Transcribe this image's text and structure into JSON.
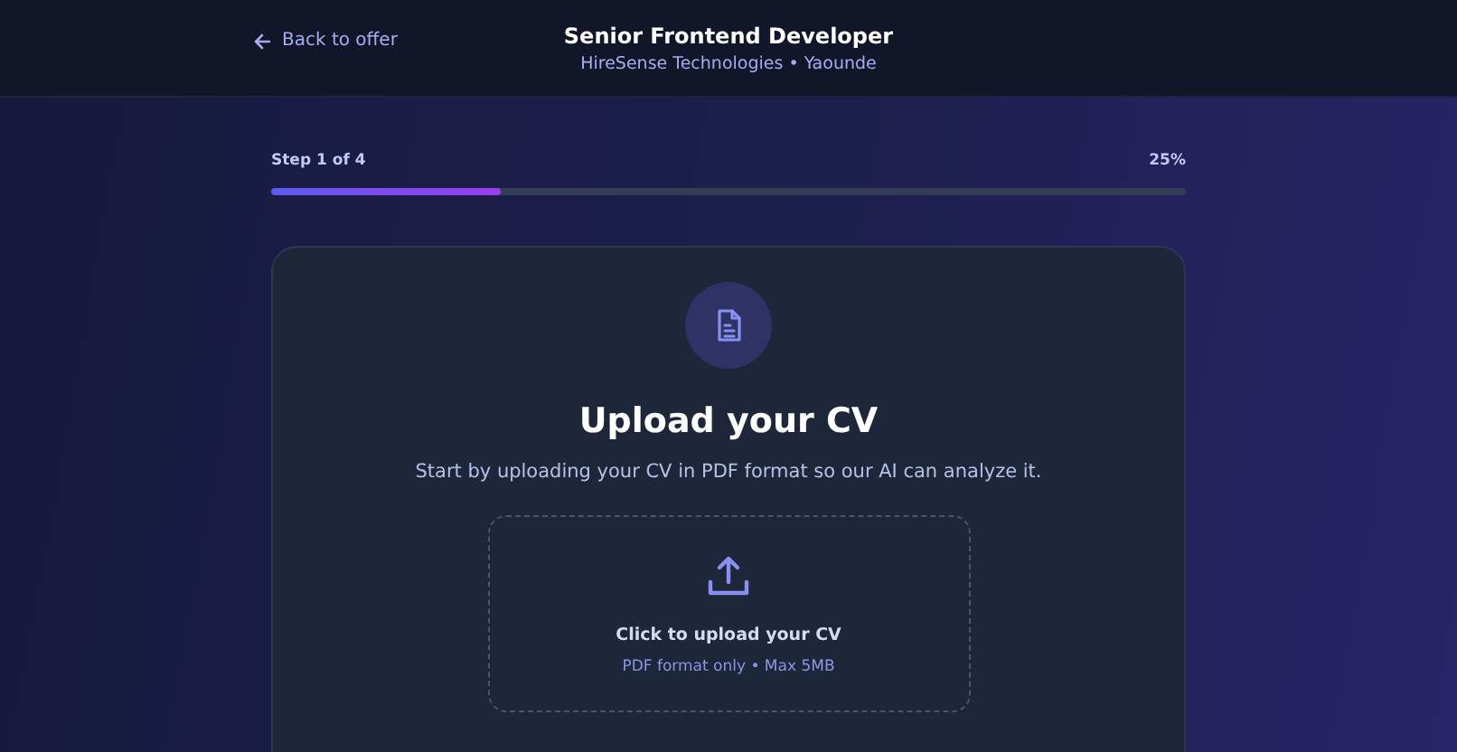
{
  "header": {
    "back_link": "Back to offer",
    "title": "Senior Frontend Developer",
    "subtitle": "HireSense Technologies • Yaounde"
  },
  "progress": {
    "step_label": "Step 1 of 4",
    "percent": "25%",
    "level": 0.25
  },
  "card": {
    "title": "Upload your CV",
    "description": "Start by uploading your CV in PDF format so our AI can analyze it.",
    "dropzone": {
      "label": "Click to upload your CV",
      "hint": "PDF format only • Max 5MB"
    }
  }
}
